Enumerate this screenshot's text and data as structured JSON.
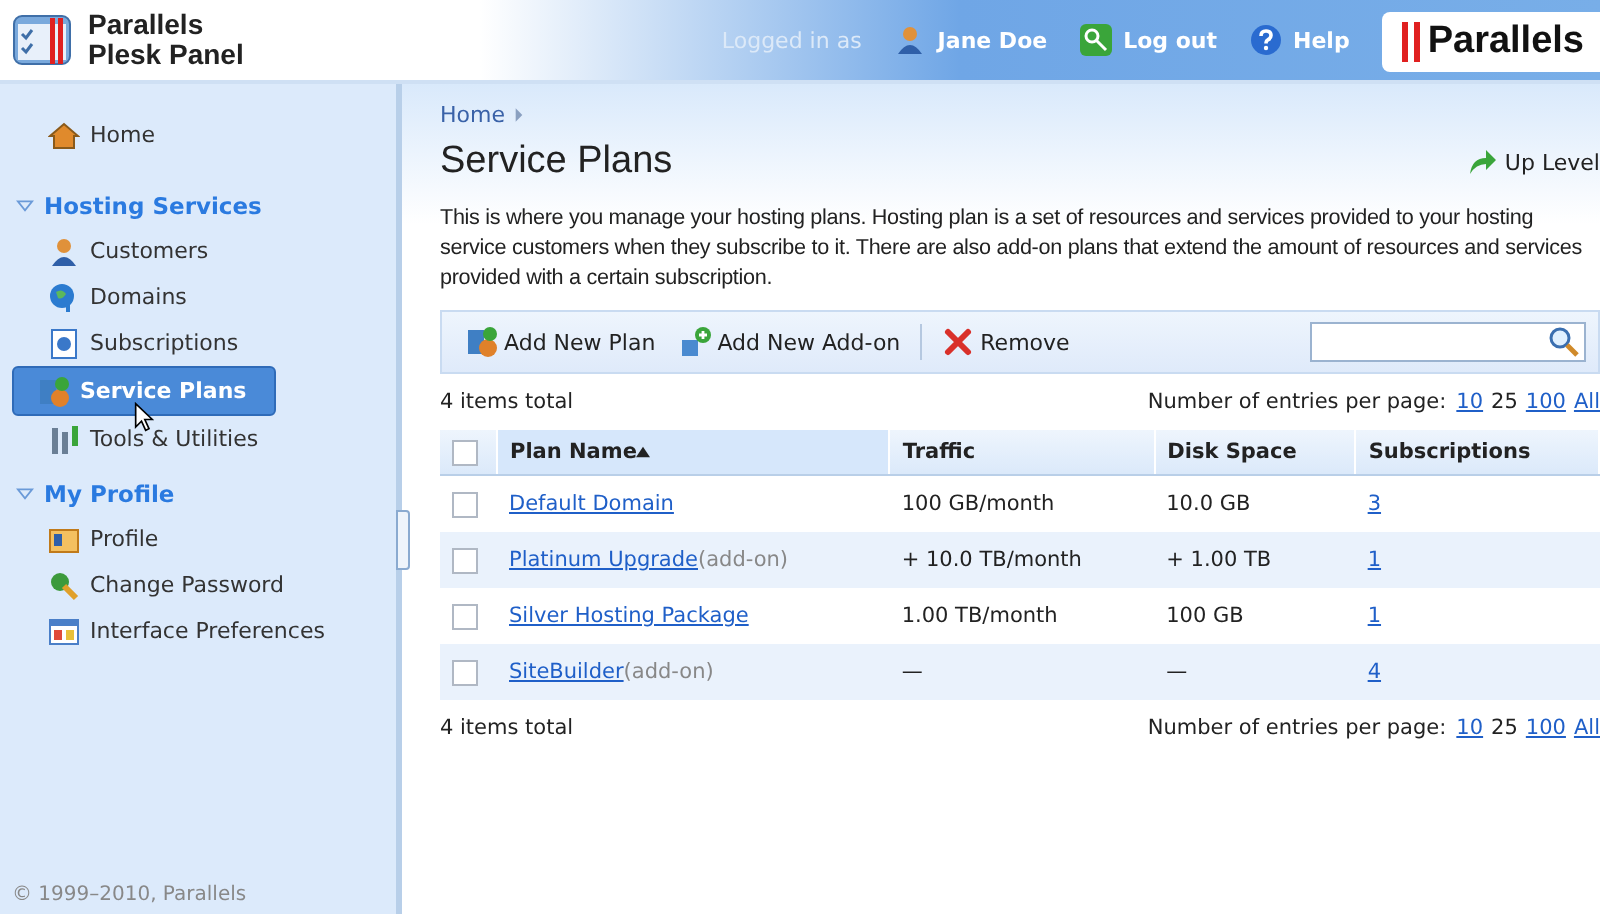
{
  "header": {
    "product": [
      "Parallels",
      "Plesk Panel"
    ],
    "logged_in_label": "Logged in as",
    "user": "Jane Doe",
    "logout": "Log out",
    "help": "Help",
    "brand": "Parallels"
  },
  "sidebar": {
    "items": [
      {
        "kind": "link",
        "label": "Home",
        "selected": false
      },
      {
        "kind": "section",
        "label": "Hosting Services",
        "expanded": true,
        "children": [
          {
            "label": "Customers",
            "selected": false
          },
          {
            "label": "Domains",
            "selected": false
          },
          {
            "label": "Subscriptions",
            "selected": false
          },
          {
            "label": "Service Plans",
            "selected": true
          },
          {
            "label": "Tools & Utilities",
            "selected": false
          }
        ]
      },
      {
        "kind": "section",
        "label": "My Profile",
        "expanded": true,
        "children": [
          {
            "label": "Profile",
            "selected": false
          },
          {
            "label": "Change Password",
            "selected": false
          },
          {
            "label": "Interface Preferences",
            "selected": false
          }
        ]
      }
    ],
    "copyright": "© 1999–2010, Parallels"
  },
  "breadcrumb": [
    "Home"
  ],
  "title": "Service Plans",
  "up_level": "Up Level",
  "description": "This is where you manage your hosting plans. Hosting plan is a set of resources and services provided to your hosting service customers when they subscribe to it. There are also add-on plans that extend the amount of resources and services provided with a certain subscription.",
  "toolbar": {
    "buttons": [
      {
        "label": "Add New Plan"
      },
      {
        "label": "Add New Add-on"
      },
      {
        "label": "Remove"
      }
    ]
  },
  "pager_top": {
    "total": "4 items total",
    "label": "Number of entries per page:",
    "options": [
      {
        "label": "10",
        "selected": false
      },
      {
        "label": "25",
        "selected": true
      },
      {
        "label": "100",
        "selected": false
      },
      {
        "label": "All",
        "selected": false
      }
    ]
  },
  "table": {
    "select_all_checked": false,
    "columns": [
      {
        "label": "Plan Name",
        "sorted": true
      },
      {
        "label": "Traffic",
        "sorted": false
      },
      {
        "label": "Disk Space",
        "sorted": false
      },
      {
        "label": "Subscriptions",
        "sorted": false
      }
    ],
    "rows": [
      {
        "checked": false,
        "name": "Default Domain",
        "traffic": "100 GB/month",
        "disk": "10.0 GB",
        "subscriptions": "3"
      },
      {
        "checked": false,
        "name": "Platinum Upgrade",
        "tag": "(add-on)",
        "traffic": "+ 10.0 TB/month",
        "disk": "+ 1.00 TB",
        "subscriptions": "1"
      },
      {
        "checked": false,
        "name": "Silver Hosting Package",
        "traffic": "1.00 TB/month",
        "disk": "100 GB",
        "subscriptions": "1"
      },
      {
        "checked": false,
        "name": "SiteBuilder",
        "tag": "(add-on)",
        "traffic": "—",
        "disk": "—",
        "subscriptions": "4"
      }
    ]
  },
  "pager_bottom": {
    "total": "4 items total",
    "label": "Number of entries per page:",
    "options": [
      {
        "label": "10",
        "selected": false
      },
      {
        "label": "25",
        "selected": true
      },
      {
        "label": "100",
        "selected": false
      },
      {
        "label": "All",
        "selected": false
      }
    ]
  }
}
